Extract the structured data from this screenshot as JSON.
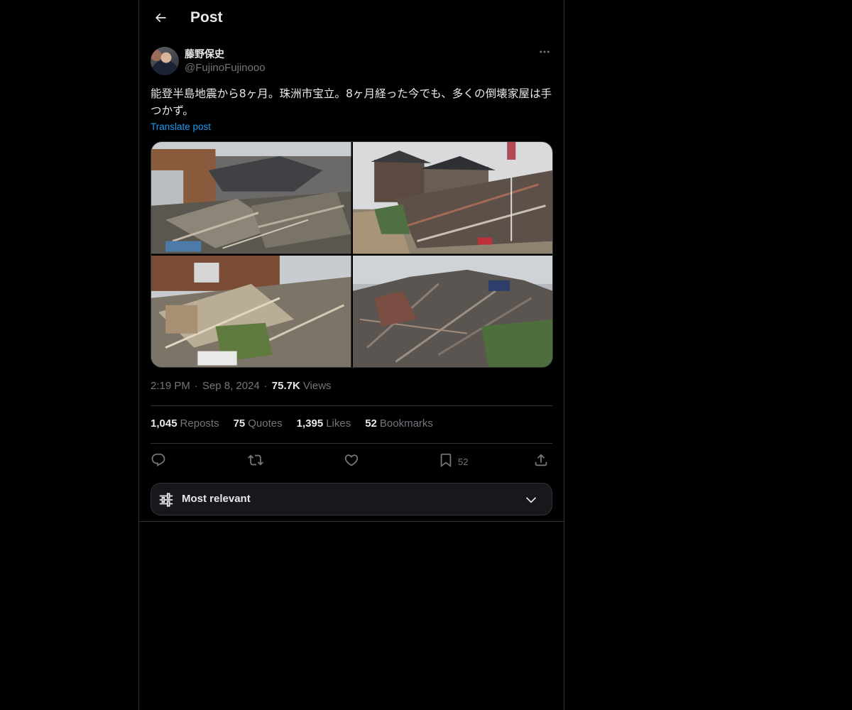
{
  "header": {
    "title": "Post",
    "back_icon": "arrow-left-icon"
  },
  "author": {
    "name": "藤野保史",
    "handle": "@FujinoFujinooo"
  },
  "post": {
    "text": "能登半島地震から8ヶ月。珠洲市宝立。8ヶ月経った今でも、多くの倒壊家屋は手つかず。",
    "translate_label": "Translate post"
  },
  "meta": {
    "time": "2:19 PM",
    "date": "Sep 8, 2024",
    "views_count": "75.7K",
    "views_label": "Views",
    "separator": "·"
  },
  "stats": {
    "reposts": {
      "count": "1,045",
      "label": "Reposts"
    },
    "quotes": {
      "count": "75",
      "label": "Quotes"
    },
    "likes": {
      "count": "1,395",
      "label": "Likes"
    },
    "bookmarks": {
      "count": "52",
      "label": "Bookmarks"
    }
  },
  "actions": {
    "bookmark_count": "52"
  },
  "sort": {
    "label": "Most relevant"
  },
  "colors": {
    "background": "#000000",
    "text": "#e7e9ea",
    "muted": "#71767b",
    "link": "#1d9bf0",
    "border": "#2f3336"
  }
}
